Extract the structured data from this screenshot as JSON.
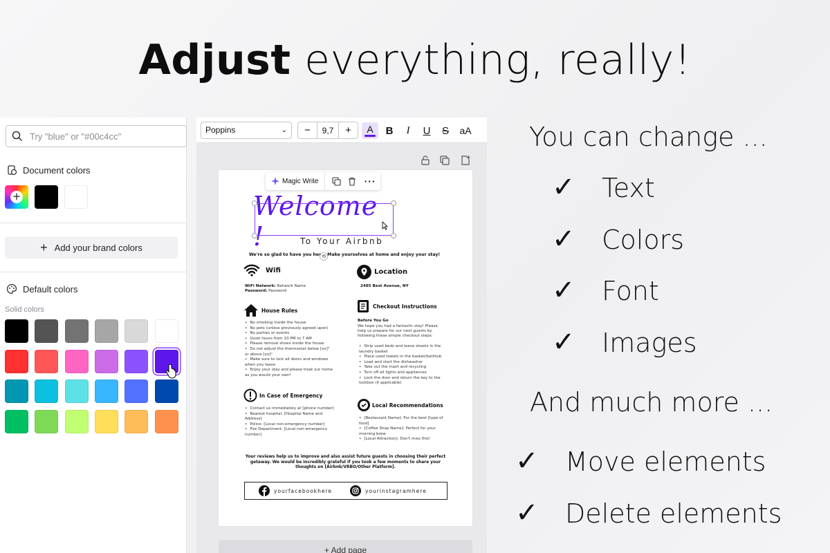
{
  "headline": {
    "bold": "Adjust",
    "rest": " everything, really!"
  },
  "color_panel": {
    "search_placeholder": "Try \"blue\" or \"#00c4cc\"",
    "document_colors_title": "Document colors",
    "document_colors": [
      "#000000",
      "#ffffff"
    ],
    "brand_button": "Add your brand colors",
    "default_colors_title": "Default colors",
    "solid_colors_label": "Solid colors",
    "solid_colors": [
      [
        "#000000",
        "#545454",
        "#737373",
        "#a6a6a6",
        "#d9d9d9",
        "#ffffff"
      ],
      [
        "#ff3131",
        "#ff5757",
        "#ff66c4",
        "#cb6ce6",
        "#8c52ff",
        "#5e17eb"
      ],
      [
        "#0097b2",
        "#0cc0df",
        "#5ce1e6",
        "#38b6ff",
        "#5271ff",
        "#004aad"
      ],
      [
        "#00bf63",
        "#7ed957",
        "#c1ff72",
        "#ffde59",
        "#ffbd59",
        "#ff914d"
      ]
    ],
    "selected_color": "#5e17eb"
  },
  "toolbar": {
    "font": "Poppins",
    "minus": "−",
    "font_size": "9,7",
    "plus": "+",
    "text_color_label": "A",
    "bold": "B",
    "italic": "I",
    "underline": "U",
    "strike": "S",
    "case": "aA",
    "text_color_accent": "#5e17eb"
  },
  "canvas": {
    "magic_write": "Magic Write",
    "welcome": "Welcome !",
    "to_airbnb": "To Your Airbnb",
    "glad": "We're so glad to have you here! Make yourselves at home and enjoy your stay!",
    "wifi": {
      "title": "Wifi",
      "network_label": "WiFi Network:",
      "network_value": " Network Name",
      "password_label": "Password:",
      "password_value": " Password"
    },
    "location": {
      "title": "Location",
      "address": "2485 Best Avenue, NY"
    },
    "house_rules": {
      "title": "House Rules",
      "items": [
        "No smoking inside the house",
        "No pets (unless previously agreed upon)",
        "No parties or events",
        "Quiet hours from 10 PM to 7 AM",
        "Please remove shoes inside the house",
        "Do not adjust the thermostat below [xx]° or above [xx]°",
        "Make sure to lock all doors and windows when you leave",
        "Enjoy your stay and please treat our home as you would your own!"
      ]
    },
    "checkout": {
      "title": "Checkout Instructions",
      "subtitle": "Before You Go",
      "intro": "We hope you had a fantastic stay! Please help us prepare for our next guests by following these simple checkout steps:",
      "items": [
        "Strip used beds and leave sheets in the laundry basket",
        "Place used towels in the basket/bathtub",
        "Load and start the dishwasher",
        "Take out the trash and recycling",
        "Turn off all lights and appliances",
        "Lock the door and return the key to the lockbox (if applicable)"
      ]
    },
    "emergency": {
      "title": "In Case of Emergency",
      "items": [
        "Contact us immediately at [phone number]",
        "Nearest hospital: [Hospital Name and Address]",
        "Police: [Local non-emergency number]",
        "Fire Department: [Local non-emergency number]"
      ]
    },
    "recommendations": {
      "title": "Local Recommendations",
      "items": [
        "[Restaurant Name]: For the best [type of food]",
        "[Coffee Shop Name]: Perfect for your morning brew",
        "[Local Attraction]: Don't miss this!"
      ]
    },
    "footer_note": "Your reviews help us to improve and also assist future guests in choosing their perfect getaway. We would be incredibly grateful if you took a few moments to share your thoughts on [Airbnb/VRBO/Other Platform].",
    "facebook": "yourfacebookhere",
    "instagram": "yourinstagramhere",
    "add_page": "+ Add page"
  },
  "features": {
    "intro": "You can change ...",
    "list1": [
      "Text",
      "Colors",
      "Font",
      "Images"
    ],
    "more": "And much more ...",
    "list2": [
      "Move elements",
      "Delete elements"
    ],
    "check_glyph": "✓"
  }
}
